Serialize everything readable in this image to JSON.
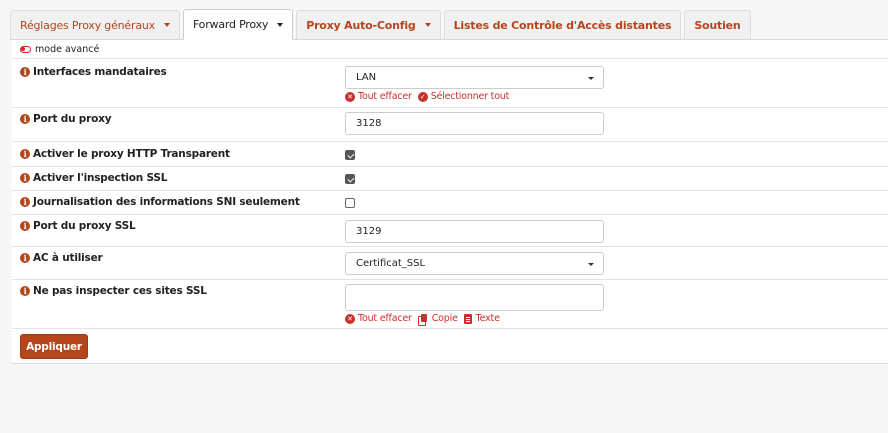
{
  "tabs": [
    {
      "label": "Réglages Proxy généraux",
      "active": false,
      "dropdown": true
    },
    {
      "label": "Forward Proxy",
      "active": true,
      "dropdown": true
    },
    {
      "label": "Proxy Auto-Config",
      "active": false,
      "dropdown": true
    },
    {
      "label": "Listes de Contrôle d'Accès distantes",
      "active": false,
      "dropdown": false
    },
    {
      "label": "Soutien",
      "active": false,
      "dropdown": false
    }
  ],
  "advanced_mode": {
    "label": "mode avancé",
    "enabled": false
  },
  "fields": {
    "interfaces": {
      "label": "Interfaces mandataires",
      "value": "LAN",
      "clear_all": "Tout effacer",
      "select_all": "Sélectionner tout"
    },
    "proxy_port": {
      "label": "Port du proxy",
      "value": "3128"
    },
    "transparent_http": {
      "label": "Activer le proxy HTTP Transparent",
      "checked": true
    },
    "ssl_inspection": {
      "label": "Activer l'inspection SSL",
      "checked": true
    },
    "sni_logging": {
      "label": "Journalisation des informations SNI seulement",
      "checked": false
    },
    "ssl_port": {
      "label": "Port du proxy SSL",
      "value": "3129"
    },
    "ca": {
      "label": "AC à utiliser",
      "value": "Certificat_SSL"
    },
    "no_inspect": {
      "label": "Ne pas inspecter ces sites SSL",
      "value": "",
      "clear_all": "Tout effacer",
      "copy": "Copie",
      "text": "Texte"
    }
  },
  "apply_button": "Appliquer",
  "colors": {
    "accent": "#b5451b",
    "danger": "#c9302c"
  }
}
